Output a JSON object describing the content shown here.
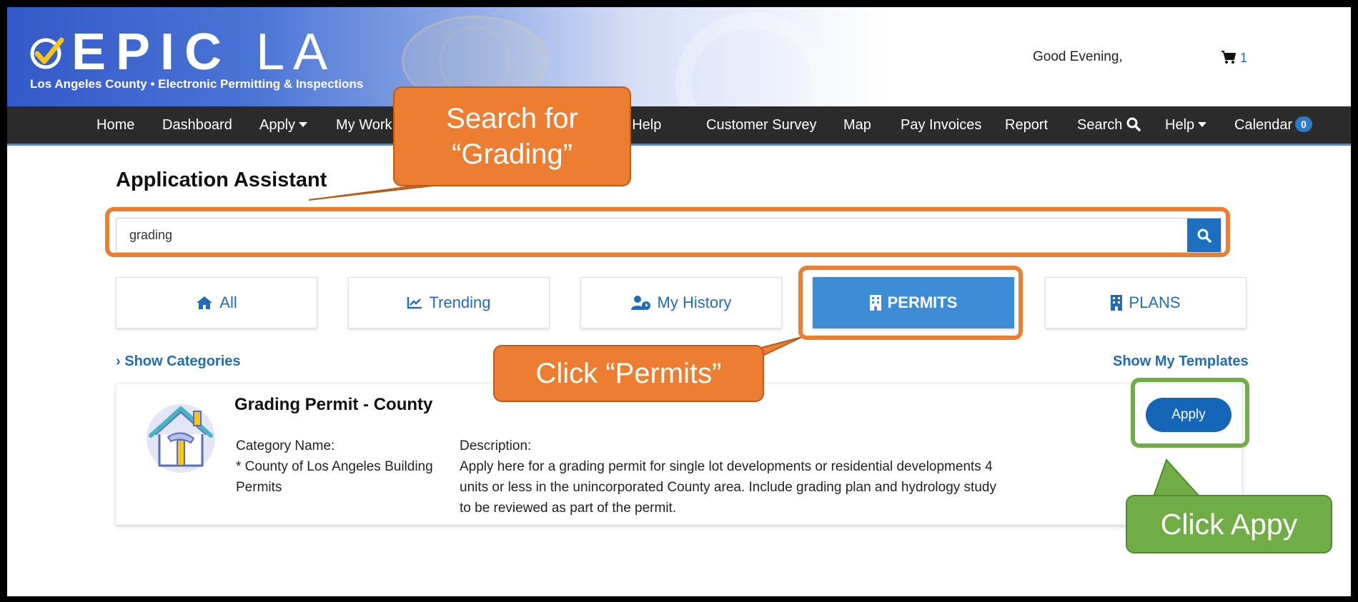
{
  "header": {
    "logo_title_main": "EPIC",
    "logo_title_la": "LA",
    "logo_subtitle": "Los Angeles County • Electronic Permitting & Inspections",
    "greeting": "Good Evening,",
    "cart_count": "1"
  },
  "nav": {
    "items": [
      {
        "label": "Home"
      },
      {
        "label": "Dashboard"
      },
      {
        "label": "Apply"
      },
      {
        "label": "My Work"
      },
      {
        "label": "mit Help"
      },
      {
        "label": "Customer Survey"
      },
      {
        "label": "Map"
      },
      {
        "label": "Pay Invoices"
      },
      {
        "label": "Report"
      },
      {
        "label": "Search"
      },
      {
        "label": "Help"
      },
      {
        "label": "Calendar"
      }
    ],
    "calendar_badge": "0"
  },
  "page": {
    "title": "Application Assistant",
    "search_value": "grading",
    "tabs": [
      {
        "label": "All",
        "icon": "home-icon"
      },
      {
        "label": "Trending",
        "icon": "trending-chart-icon"
      },
      {
        "label": "My History",
        "icon": "user-clock-icon"
      },
      {
        "label": "PERMITS",
        "icon": "building-icon",
        "active": true
      },
      {
        "label": "PLANS",
        "icon": "building-icon"
      }
    ],
    "show_categories": "Show Categories",
    "show_templates": "Show My Templates"
  },
  "result": {
    "title": "Grading Permit - County",
    "category_label": "Category Name:",
    "category_line1": "* County of Los Angeles Building",
    "category_line2": "Permits",
    "description_label": "Description:",
    "description_line1": "Apply here for a grading permit for single lot developments or residential developments 4",
    "description_line2": "units or less in the unincorporated County area. Include grading plan and hydrology study",
    "description_line3": "to be reviewed as part of the permit.",
    "apply_label": "Apply"
  },
  "annotations": {
    "search_callout_line1": "Search for",
    "search_callout_line2": "“Grading”",
    "permits_callout": "Click “Permits”",
    "apply_callout": "Click Appy",
    "orange": "#ed7d31",
    "green": "#70ad47"
  }
}
